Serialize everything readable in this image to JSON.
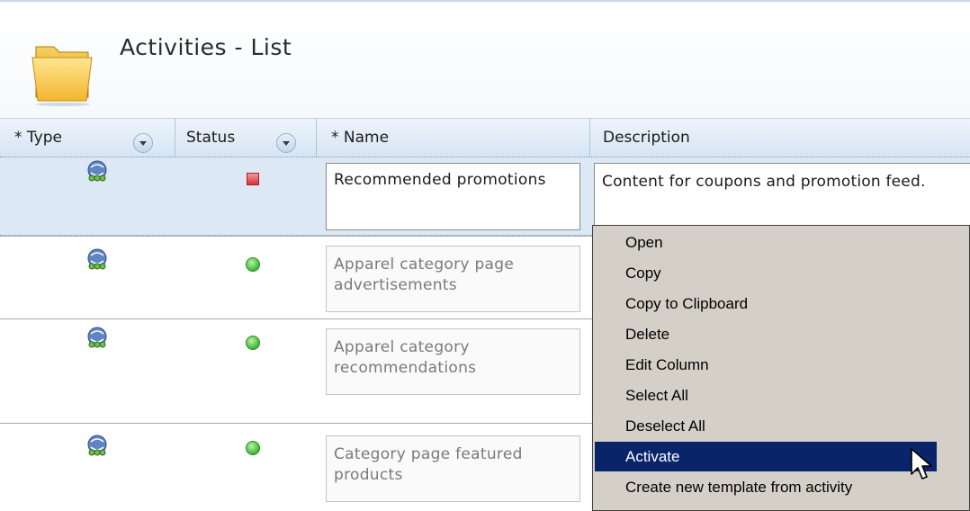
{
  "page": {
    "title": "Activities - List",
    "folder_icon": "folder-icon"
  },
  "columns": [
    {
      "label": "* Type",
      "sortable": true
    },
    {
      "label": "Status",
      "sortable": true
    },
    {
      "label": "* Name",
      "sortable": false
    },
    {
      "label": "Description",
      "sortable": false
    }
  ],
  "rows": [
    {
      "type_icon": "activity-type-icon",
      "status": "inactive",
      "name": "Recommended promotions",
      "description": "Content for coupons and promotion feed.",
      "selected": true
    },
    {
      "type_icon": "activity-type-icon",
      "status": "active",
      "name": "Apparel category page advertisements",
      "description": "",
      "selected": false
    },
    {
      "type_icon": "activity-type-icon",
      "status": "active",
      "name": "Apparel category recommendations",
      "description": "",
      "selected": false
    },
    {
      "type_icon": "activity-type-icon",
      "status": "active",
      "name": "Category page featured products",
      "description": "",
      "selected": false
    }
  ],
  "context_menu": {
    "items": [
      "Open",
      "Copy",
      "Copy to Clipboard",
      "Delete",
      "Edit Column",
      "Select All",
      "Deselect All",
      "Activate",
      "Create new template from activity"
    ],
    "highlighted": "Activate"
  },
  "colors": {
    "menu_bg": "#d4d0c8",
    "menu_highlight": "#0a246a",
    "header_bg": "#d6e5f4",
    "selected_row": "#dde8f5"
  }
}
